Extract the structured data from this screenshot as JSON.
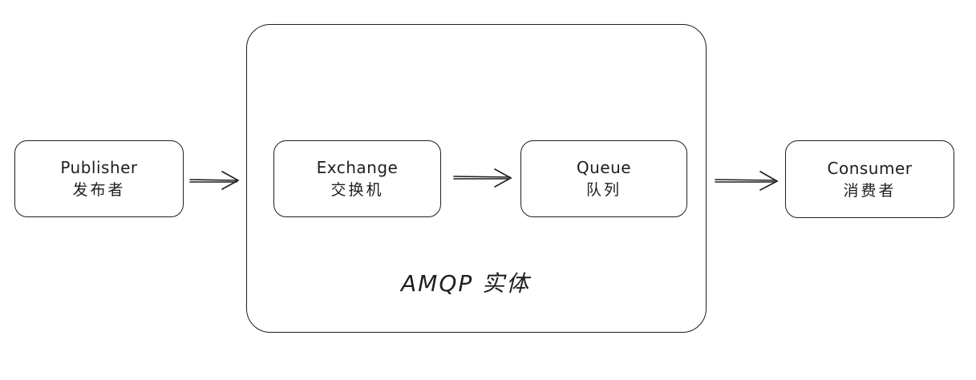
{
  "nodes": {
    "publisher": {
      "title": "Publisher",
      "subtitle": "发布者"
    },
    "exchange": {
      "title": "Exchange",
      "subtitle": "交换机"
    },
    "queue": {
      "title": "Queue",
      "subtitle": "队列"
    },
    "consumer": {
      "title": "Consumer",
      "subtitle": "消费者"
    }
  },
  "group": {
    "label": "AMQP 实体"
  },
  "colors": {
    "stroke": "#1e1e1e",
    "background": "#ffffff"
  }
}
